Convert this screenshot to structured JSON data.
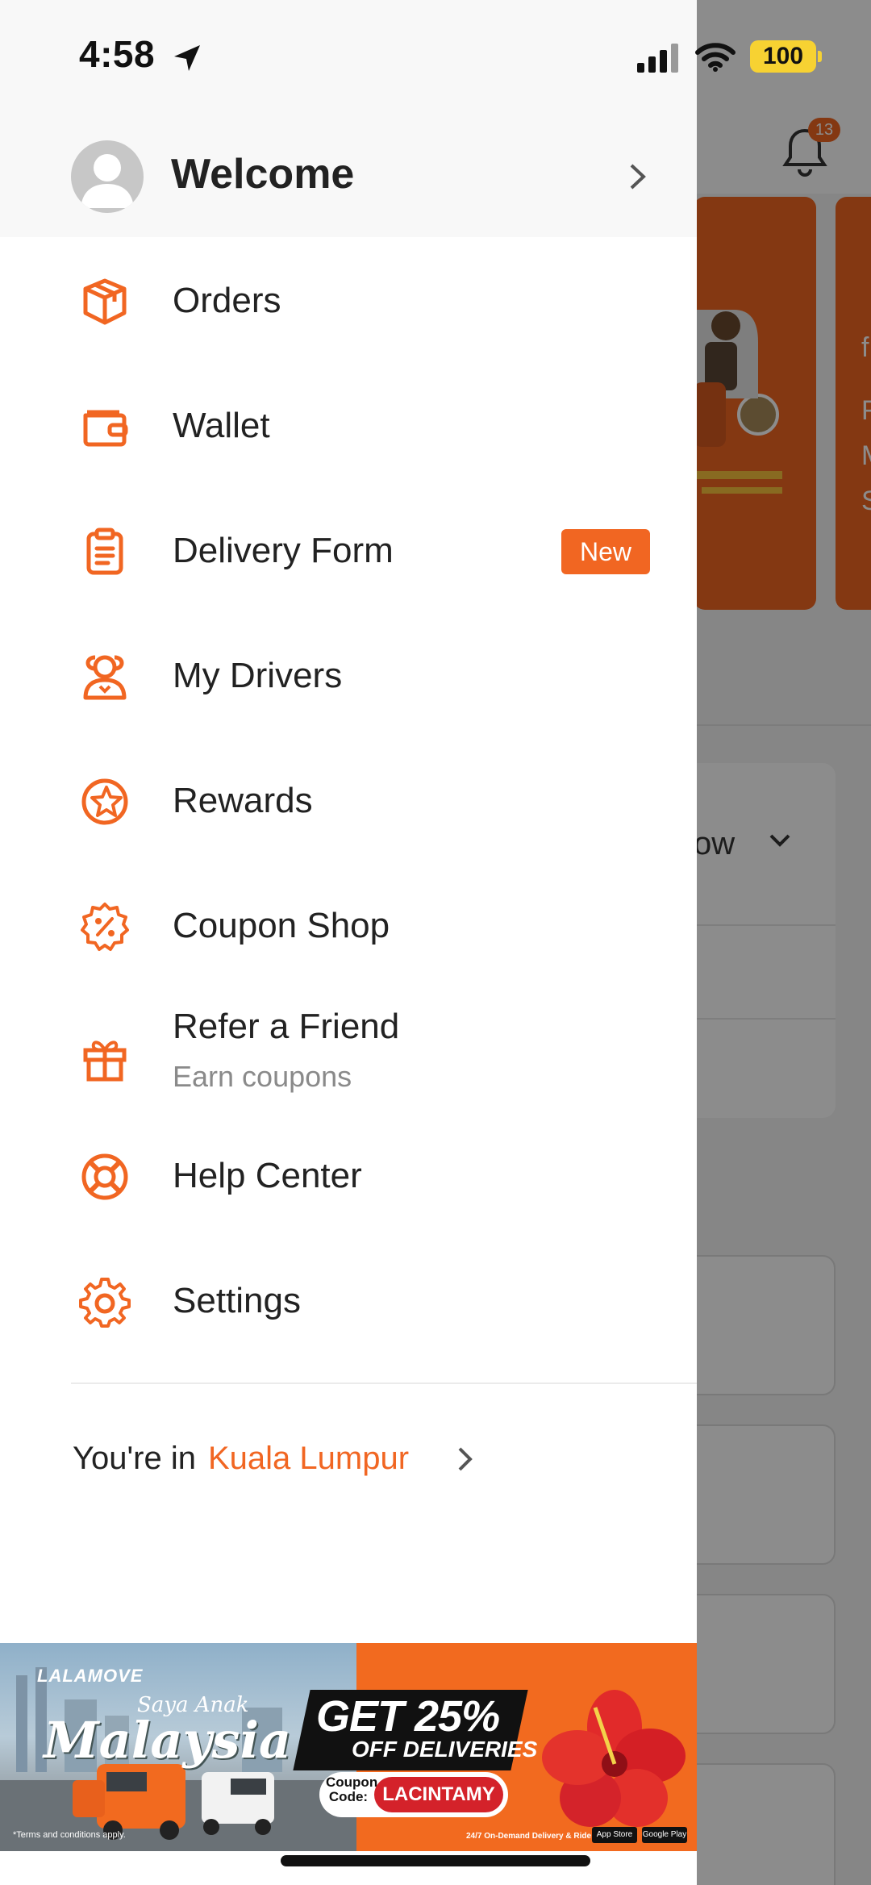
{
  "status_bar": {
    "time": "4:58",
    "battery": "100"
  },
  "background": {
    "notification_count": "13",
    "promo_card_text": [
      "f",
      "F",
      "M",
      "S"
    ],
    "dropdown_partial_text": "ow"
  },
  "drawer": {
    "welcome_label": "Welcome",
    "menu": [
      {
        "label": "Orders",
        "icon": "package-icon"
      },
      {
        "label": "Wallet",
        "icon": "wallet-icon"
      },
      {
        "label": "Delivery Form",
        "icon": "clipboard-icon",
        "badge": "New"
      },
      {
        "label": "My Drivers",
        "icon": "drivers-icon"
      },
      {
        "label": "Rewards",
        "icon": "rewards-star-icon"
      },
      {
        "label": "Coupon Shop",
        "icon": "coupon-badge-icon"
      },
      {
        "label": "Refer a Friend",
        "sublabel": "Earn coupons",
        "icon": "gift-icon"
      },
      {
        "label": "Help Center",
        "icon": "lifebuoy-icon"
      },
      {
        "label": "Settings",
        "icon": "gear-icon"
      }
    ],
    "city": {
      "prefix": "You're in",
      "name": "Kuala Lumpur"
    }
  },
  "banner": {
    "brand": "LALAMOVE",
    "tagline_small": "Saya Anak",
    "tagline_large": "Malaysia",
    "headline": "GET 25%",
    "subheadline": "OFF DELIVERIES",
    "coupon_label": "Coupon Code:",
    "coupon_code": "LACINTAMY",
    "terms": "*Terms and conditions apply.",
    "footer": "24/7 On-Demand Delivery & Ride App",
    "store_badges": [
      "App Store",
      "Google Play"
    ]
  },
  "colors": {
    "accent": "#F16622",
    "text": "#222222",
    "muted": "#8A8A8A",
    "battery": "#F7D232"
  }
}
